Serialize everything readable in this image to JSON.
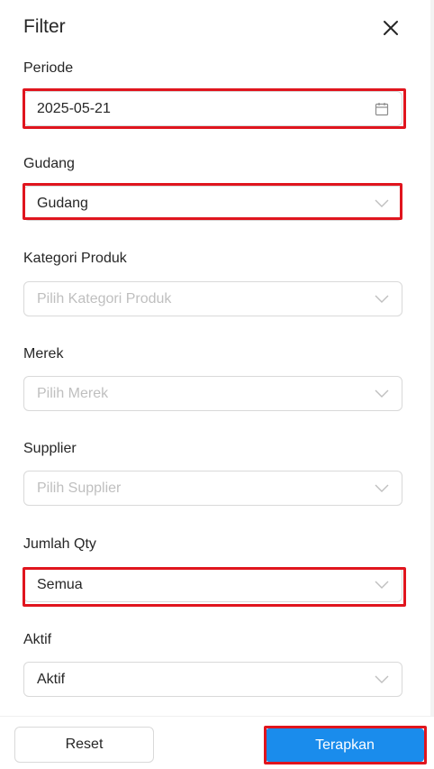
{
  "header": {
    "title": "Filter",
    "close_icon": "close-icon"
  },
  "fields": [
    {
      "label": "Periode",
      "value": "2025-05-21",
      "placeholder": "",
      "icon": "calendar-icon"
    },
    {
      "label": "Gudang",
      "value": "Gudang",
      "placeholder": "",
      "icon": "chevron-down-icon"
    },
    {
      "label": "Kategori Produk",
      "value": "",
      "placeholder": "Pilih Kategori Produk",
      "icon": "chevron-down-icon"
    },
    {
      "label": "Merek",
      "value": "",
      "placeholder": "Pilih Merek",
      "icon": "chevron-down-icon"
    },
    {
      "label": "Supplier",
      "value": "",
      "placeholder": "Pilih Supplier",
      "icon": "chevron-down-icon"
    },
    {
      "label": "Jumlah Qty",
      "value": "Semua",
      "placeholder": "",
      "icon": "chevron-down-icon"
    },
    {
      "label": "Aktif",
      "value": "Aktif",
      "placeholder": "",
      "icon": "chevron-down-icon"
    }
  ],
  "footer": {
    "reset_label": "Reset",
    "apply_label": "Terapkan"
  },
  "colors": {
    "primary": "#1a8cec",
    "highlight": "#e0151e",
    "placeholder": "#bfbfbf",
    "border": "#d9d9d9"
  }
}
